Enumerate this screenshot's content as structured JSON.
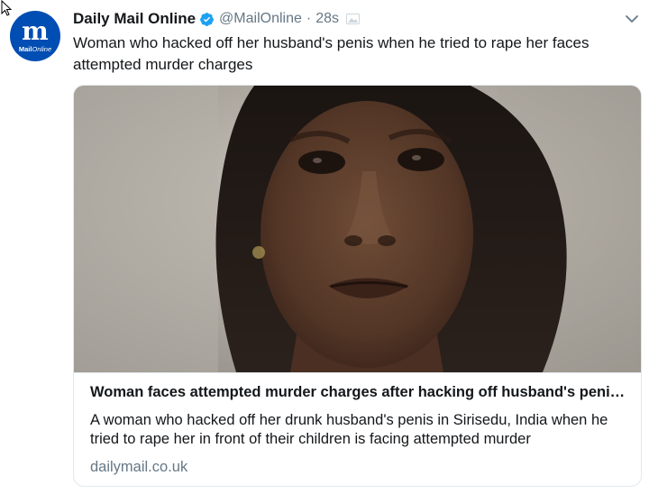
{
  "tweet": {
    "author_name": "Daily Mail Online",
    "handle": "@MailOnline",
    "separator": "·",
    "time": "28s",
    "text": "Woman who hacked off her husband's penis when he tried to rape her faces attempted murder charges"
  },
  "avatar": {
    "monogram": "m",
    "wordmark_bold": "Mail",
    "wordmark_light": "Online",
    "background": "#004db3"
  },
  "card": {
    "title": "Woman faces attempted murder charges after hacking off husband's penis...",
    "description": "A woman who hacked off her drunk husband's penis in Sirisedu, India when he tried to rape her in front of their children is facing attempted murder",
    "domain": "dailymail.co.uk"
  },
  "icons": {
    "verified": "verified-badge-icon",
    "time_extra": "media-icon",
    "caret": "chevron-down-icon",
    "pointer": "cursor-icon"
  },
  "colors": {
    "verified_blue": "#1da1f2",
    "text_primary": "#14171a",
    "text_secondary": "#657786",
    "border": "#e1e8ed"
  }
}
